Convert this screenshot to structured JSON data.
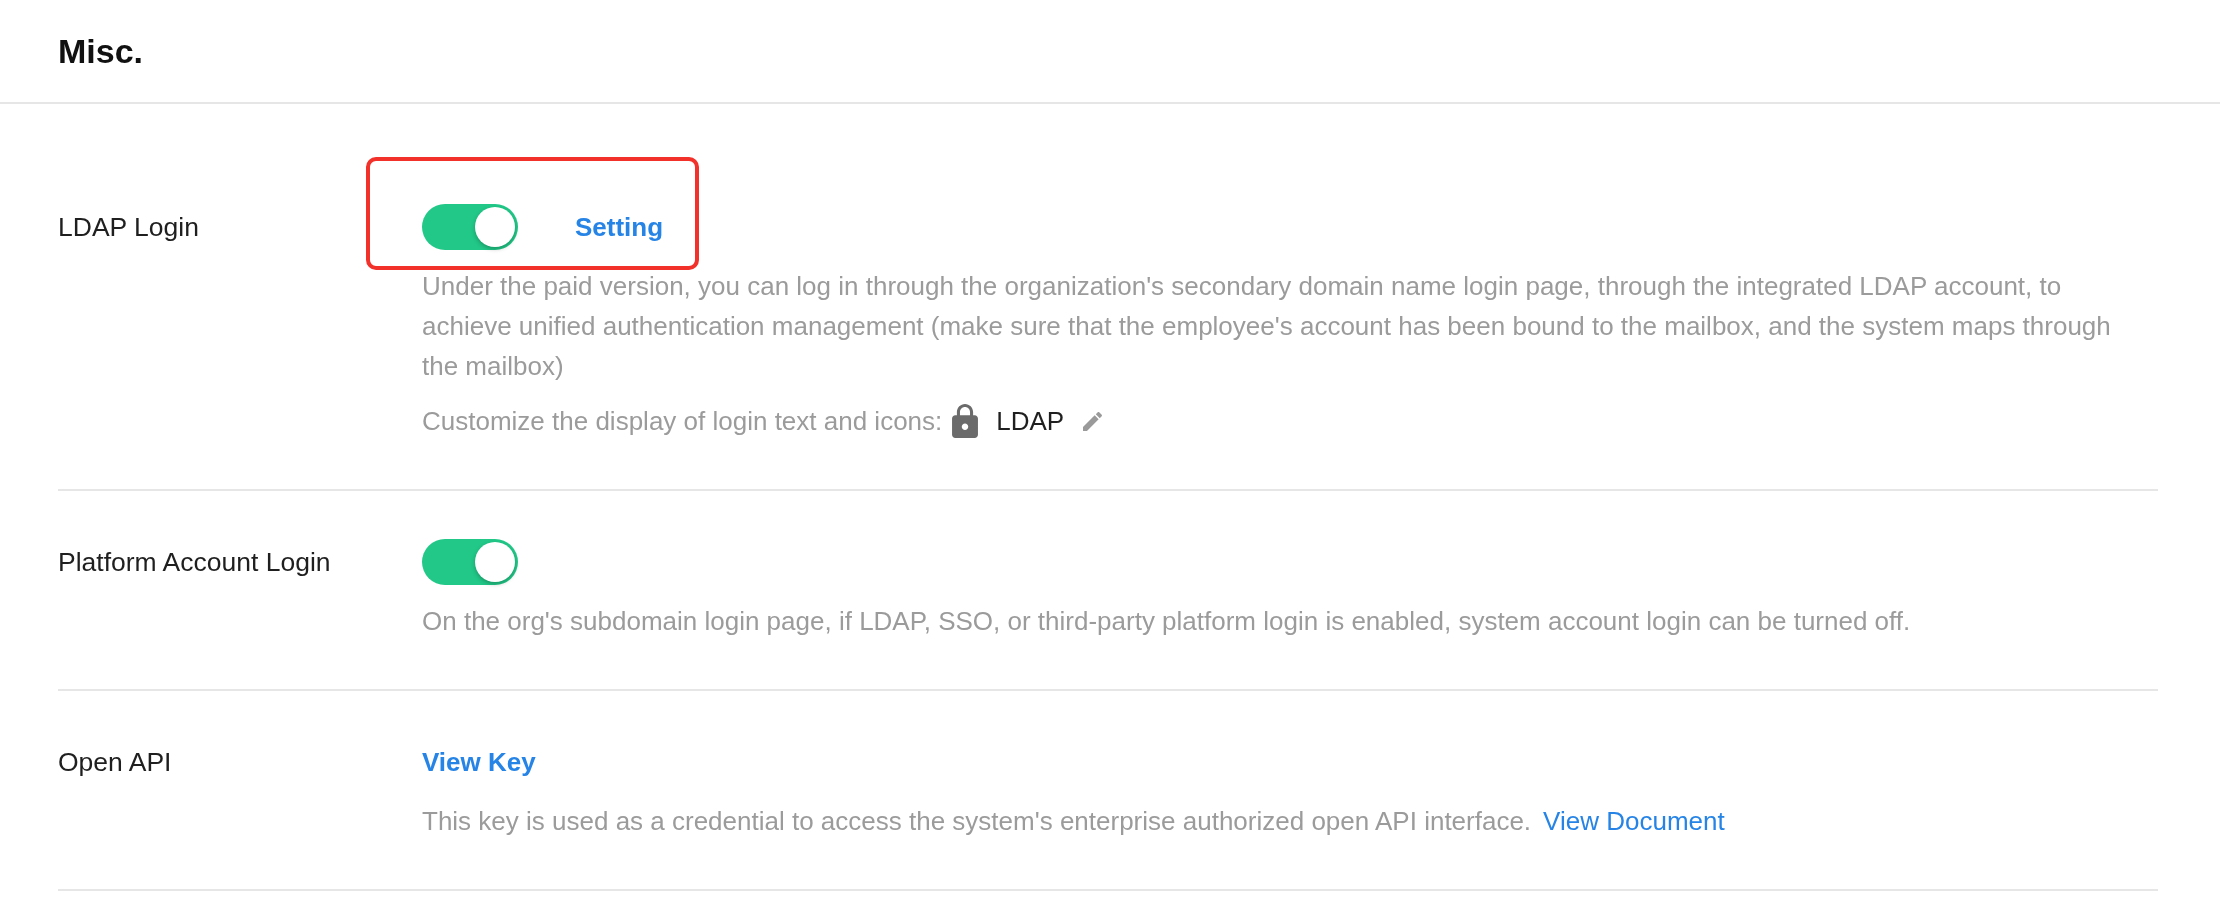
{
  "header": {
    "title": "Misc."
  },
  "rows": [
    {
      "kind": "toggle",
      "label": "LDAP Login",
      "on": true,
      "highlighted": true,
      "action": "Setting",
      "description": "Under the paid version, you can log in through the organization's secondary domain name login page, through the integrated LDAP account, to achieve unified authentication management (make sure that the employee's account has been bound to the mailbox, and the system maps through the mailbox)",
      "customize": {
        "label": "Customize the display of login text and icons:",
        "value": "LDAP"
      }
    },
    {
      "kind": "toggle",
      "label": "Platform Account Login",
      "on": true,
      "highlighted": false,
      "description": "On the org's subdomain login page, if LDAP, SSO, or third-party platform login is enabled, system account login can be turned off."
    },
    {
      "kind": "link",
      "label": "Open API",
      "highlighted": false,
      "action": "View Key",
      "description": "This key is used as a credential to access the system's enterprise authorized open API interface.",
      "doc_link": "View Document"
    }
  ]
}
